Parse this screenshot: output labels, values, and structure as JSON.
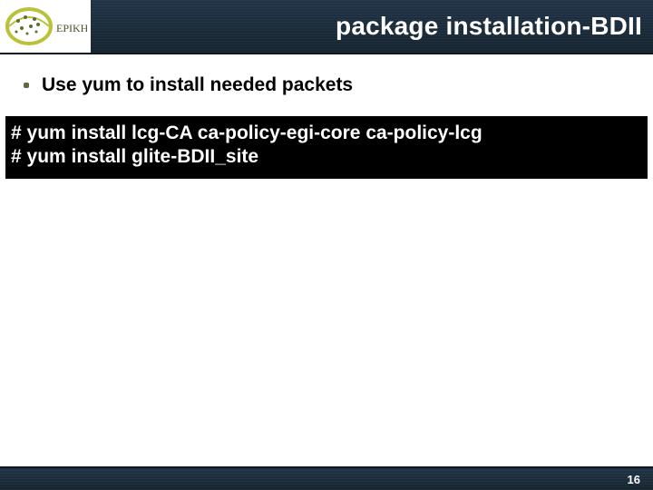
{
  "header": {
    "title": "package installation-BDII",
    "logo_text": "EPIKH"
  },
  "body": {
    "bullet": "Use yum to install needed packets",
    "code_lines": [
      "# yum install lcg-CA ca-policy-egi-core ca-policy-lcg",
      "# yum install glite-BDII_site"
    ]
  },
  "footer": {
    "page_number": "16"
  }
}
